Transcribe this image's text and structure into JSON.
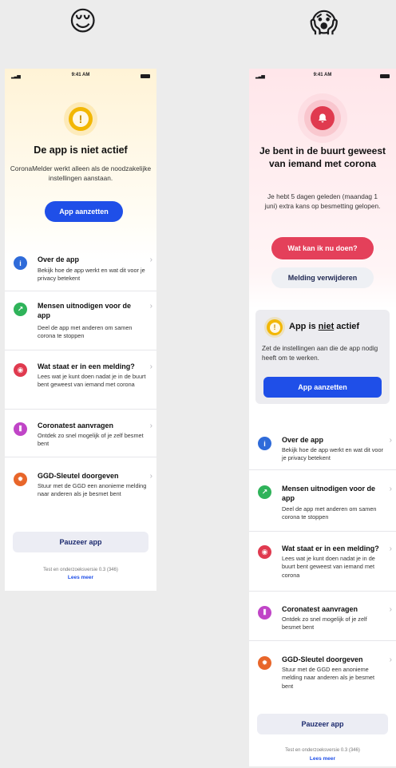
{
  "emojis": {
    "left": "😌",
    "right": "😱"
  },
  "status_bar": {
    "time": "9:41 AM"
  },
  "left_screen": {
    "title": "De app is niet actief",
    "description": "CoronaMelder werkt alleen als de noodzakelijke instellingen aanstaan.",
    "enable_button": "App aanzetten",
    "items": [
      {
        "title": "Over de app",
        "desc": "Bekijk hoe de app werkt en wat dit voor je privacy betekent"
      },
      {
        "title": "Mensen uitnodigen voor de app",
        "desc": "Deel de app met anderen om samen corona te stoppen"
      },
      {
        "title": "Wat staat er in een melding?",
        "desc": "Lees wat je kunt doen nadat je in de buurt bent geweest van iemand met corona"
      },
      {
        "title": "Coronatest aanvragen",
        "desc": "Ontdek zo snel mogelijk of je zelf besmet bent"
      },
      {
        "title": "GGD-Sleutel doorgeven",
        "desc": "Stuur met de GGD een anonieme melding naar anderen als je besmet bent"
      }
    ],
    "pause_button": "Pauzeer app",
    "version": "Test en onderzoeksversie 0.3 (346)",
    "read_more": "Lees meer"
  },
  "right_screen": {
    "title": "Je bent in de buurt geweest van iemand met corona",
    "description": "Je hebt 5 dagen geleden (maandag 1 juni) extra kans op besmetting gelopen.",
    "action_button": "Wat kan ik nu doen?",
    "remove_button": "Melding verwijderen",
    "card": {
      "title_prefix": "App is ",
      "title_emph": "niet",
      "title_suffix": " actief",
      "description": "Zet de instellingen aan die de app nodig heeft om te werken.",
      "button": "App aanzetten"
    },
    "items": [
      {
        "title": "Over de app",
        "desc": "Bekijk hoe de app werkt en wat dit voor je privacy betekent"
      },
      {
        "title": "Mensen uitnodigen voor de app",
        "desc": "Deel de app met anderen om samen corona te stoppen"
      },
      {
        "title": "Wat staat er in een melding?",
        "desc": "Lees wat je kunt doen nadat je in de buurt bent geweest van iemand met corona"
      },
      {
        "title": "Coronatest aanvragen",
        "desc": "Ontdek zo snel mogelijk of je zelf besmet bent"
      },
      {
        "title": "GGD-Sleutel doorgeven",
        "desc": "Stuur met de GGD een anonieme melding naar anderen als je besmet bent"
      }
    ],
    "pause_button": "Pauzeer app",
    "version": "Test en onderzoeksversie 0.3 (346)",
    "read_more": "Lees meer"
  },
  "colors": {
    "primary_blue": "#1f4fe8",
    "alert_red": "#e4405a",
    "warning_yellow": "#f2b705",
    "info_icon": "#2f6bd9",
    "share_icon": "#2fb35a",
    "alert_icon": "#e03a4f",
    "test_icon": "#c045c7",
    "key_icon": "#e8662a"
  },
  "icons": [
    "signal-icon",
    "battery-icon",
    "warning-icon",
    "bell-icon",
    "info-icon",
    "share-icon",
    "alert-icon",
    "test-tube-icon",
    "key-icon",
    "chevron-right-icon"
  ]
}
